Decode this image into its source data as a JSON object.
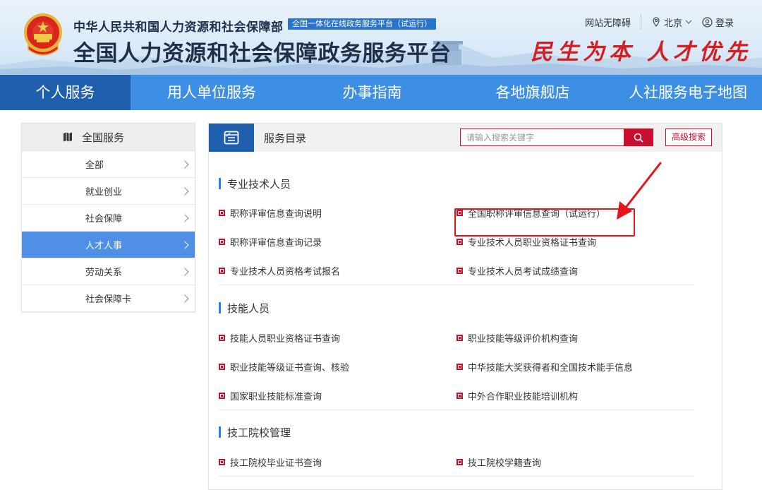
{
  "header": {
    "ministry_name": "中华人民共和国人力资源和社会保障部",
    "ministry_tag": "全国一体化在线政务服务平台（试运行）",
    "platform_title": "全国人力资源和社会保障政务服务平台",
    "slogan": "民生为本 人才优先",
    "accessibility_link": "网站无障碍",
    "location": "北京",
    "login": "登录"
  },
  "nav": {
    "items": [
      {
        "label": "个人服务"
      },
      {
        "label": "用人单位服务"
      },
      {
        "label": "办事指南"
      },
      {
        "label": "各地旗舰店"
      },
      {
        "label": "人社服务电子地图"
      }
    ],
    "active_index": 0
  },
  "sidebar": {
    "title": "全国服务",
    "items": [
      {
        "label": "全部"
      },
      {
        "label": "就业创业"
      },
      {
        "label": "社会保障"
      },
      {
        "label": "人才人事"
      },
      {
        "label": "劳动关系"
      },
      {
        "label": "社会保障卡"
      }
    ],
    "active_index": 3
  },
  "main": {
    "title": "服务目录",
    "search_placeholder": "请输入搜索关键字",
    "advanced_search": "高级搜索",
    "sections": [
      {
        "title": "专业技术人员",
        "links": [
          [
            "职称评审信息查询说明",
            "全国职称评审信息查询（试运行）"
          ],
          [
            "职称评审信息查询记录",
            "专业技术人员职业资格证书查询"
          ],
          [
            "专业技术人员资格考试报名",
            "专业技术人员考试成绩查询"
          ]
        ]
      },
      {
        "title": "技能人员",
        "links": [
          [
            "技能人员职业资格证书查询",
            "职业技能等级评价机构查询"
          ],
          [
            "职业技能等级证书查询、核验",
            "中华技能大奖获得者和全国技术能手信息"
          ],
          [
            "国家职业技能标准查询",
            "中外合作职业技能培训机构"
          ]
        ]
      },
      {
        "title": "技工院校管理",
        "links": [
          [
            "技工院校毕业证书查询",
            "技工院校学籍查询"
          ]
        ]
      }
    ]
  },
  "colors": {
    "nav_blue": "#3d8fe6",
    "nav_active": "#1f5fae",
    "sidebar_active": "#4f8fe5",
    "accent_red": "#c8102e",
    "annotation_red": "#e8141c"
  }
}
